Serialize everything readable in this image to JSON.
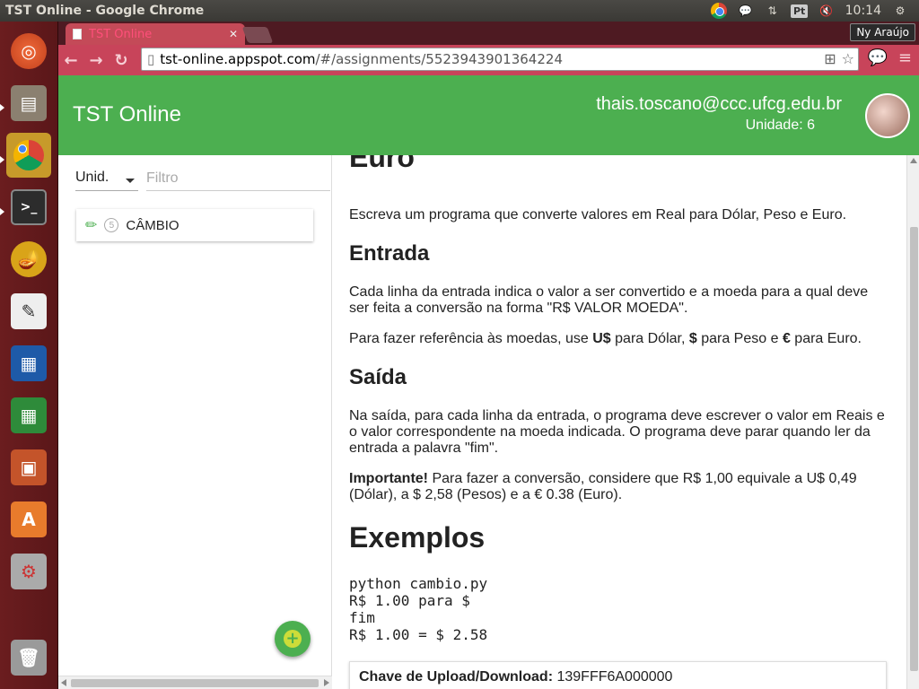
{
  "system": {
    "window_title": "TST Online - Google Chrome",
    "clock": "10:14",
    "keyboard_badge": "Pt"
  },
  "browser": {
    "tab_title": "TST Online",
    "profile_name": "Ny Araújo",
    "url_host": "tst-online.appspot.com",
    "url_path": "/#/assignments/5523943901364224"
  },
  "app": {
    "title": "TST Online",
    "user_email": "thais.toscano@ccc.ufcg.edu.br",
    "user_unit": "Unidade: 6",
    "accent_color": "#4caf50"
  },
  "sidebar": {
    "unit_select_value": "Unid.",
    "filter_placeholder": "Filtro",
    "assignments": [
      {
        "unit": "5",
        "title": "CÂMBIO"
      }
    ]
  },
  "content": {
    "partial_heading": "Euro",
    "intro": "Escreva um programa que converte valores em Real para Dólar, Peso e Euro.",
    "entrada_heading": "Entrada",
    "entrada_p1": "Cada linha da entrada indica o valor a ser convertido e a moeda para a qual deve ser feita a conversão na forma \"R$ VALOR MOEDA\".",
    "entrada_p2_a": "Para fazer referência às moedas, use ",
    "entrada_p2_usd": "U$",
    "entrada_p2_b": " para Dólar, ",
    "entrada_p2_peso": "$",
    "entrada_p2_c": " para Peso e ",
    "entrada_p2_euro": "€",
    "entrada_p2_d": " para Euro.",
    "saida_heading": "Saída",
    "saida_p1": "Na saída, para cada linha da entrada, o programa deve escrever o valor em Reais e o valor correspondente na moeda indicada. O programa deve parar quando ler da entrada a palavra \"fim\".",
    "saida_p2_bold": "Importante!",
    "saida_p2_rest": " Para fazer a conversão, considere que R$ 1,00 equivale a U$ 0,49 (Dólar), a $ 2,58 (Pesos) e a € 0.38 (Euro).",
    "exemplos_heading": "Exemplos",
    "example_code": "python cambio.py\nR$ 1.00 para $\nfim\nR$ 1.00 = $ 2.58",
    "key_label": "Chave de Upload/Download:",
    "key_value": "139FFF6A000000"
  }
}
